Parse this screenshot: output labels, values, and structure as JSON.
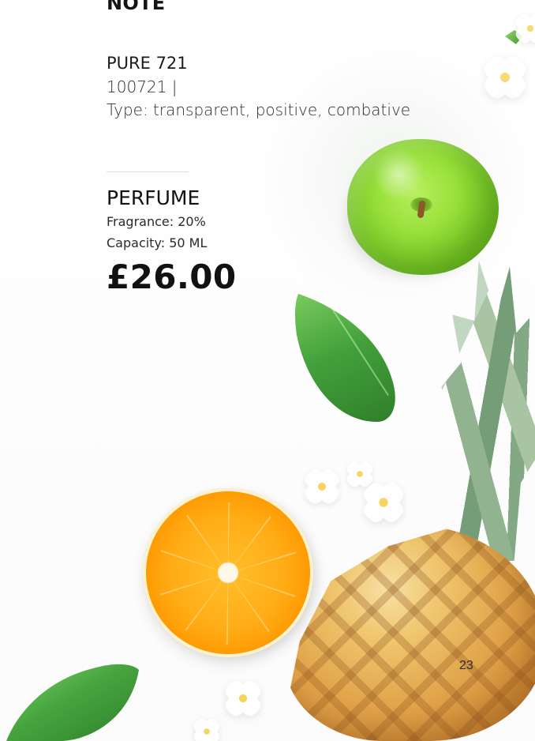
{
  "section_heading": "NOTE",
  "product": {
    "name": "PURE 721",
    "code": "100721 |",
    "type": "Type: transparent, positive, combative"
  },
  "offer": {
    "category": "PERFUME",
    "fragrance": "Fragrance: 20%",
    "capacity": "Capacity: 50 ML",
    "price": "£26.00"
  },
  "page_number": "23",
  "colors": {
    "text": "#111111",
    "secondary_text": "#2c2c2c",
    "divider": "#dddddd",
    "apple": "#9ae13c",
    "orange": "#ffad16",
    "leaf": "#46a53f",
    "pineapple": "#e1a44a"
  }
}
